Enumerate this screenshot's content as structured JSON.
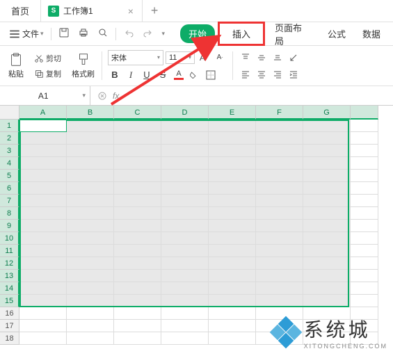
{
  "tabs": {
    "home": "首页",
    "doc": "工作簿1",
    "doc_icon": "S"
  },
  "menu": {
    "file": "文件"
  },
  "ribbon_tabs": {
    "start": "开始",
    "insert": "插入",
    "page": "页面布局",
    "formula": "公式",
    "data": "数据"
  },
  "clipboard": {
    "paste": "粘贴",
    "cut": "剪切",
    "copy": "复制",
    "format": "格式刷"
  },
  "font": {
    "name": "宋体",
    "size": "11"
  },
  "namebox": {
    "ref": "A1"
  },
  "fx": {
    "label": "fx"
  },
  "columns": [
    "A",
    "B",
    "C",
    "D",
    "E",
    "F",
    "G"
  ],
  "rows": [
    "1",
    "2",
    "3",
    "4",
    "5",
    "6",
    "7",
    "8",
    "9",
    "10",
    "11",
    "12",
    "13",
    "14",
    "15",
    "16",
    "17",
    "18"
  ],
  "selected_rows": 15,
  "watermark": {
    "main": "系统城",
    "sub": "XITONGCHENG.COM"
  }
}
